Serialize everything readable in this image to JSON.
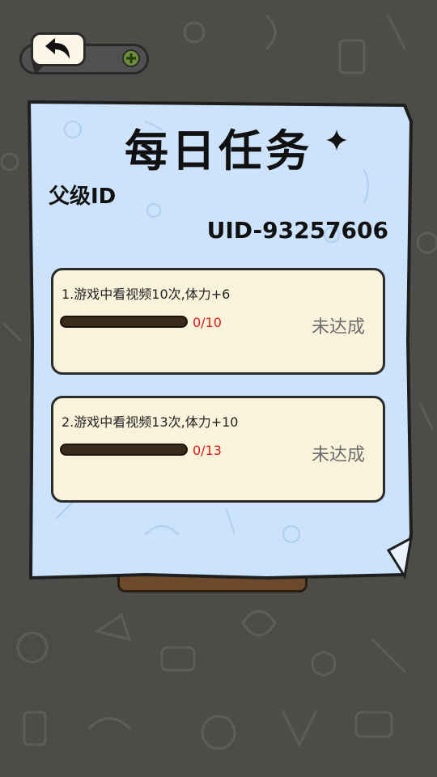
{
  "header": {
    "back_icon": "back-arrow-icon",
    "add_icon": "plus-circle-icon"
  },
  "panel": {
    "title": "每日任务",
    "parent_id_label": "父级ID",
    "uid": "UID-93257606"
  },
  "tasks": [
    {
      "title": "1.游戏中看视频10次,体力+6",
      "progress_text": "0/10",
      "progress": 0,
      "status": "未达成"
    },
    {
      "title": "2.游戏中看视频13次,体力+10",
      "progress_text": "0/13",
      "progress": 0,
      "status": "未达成"
    }
  ],
  "colors": {
    "paper": "#cce3fb",
    "card": "#faf3dc",
    "progress_text": "#e01b1b",
    "status": "#6e6e6e",
    "background": "#4d4c48"
  }
}
